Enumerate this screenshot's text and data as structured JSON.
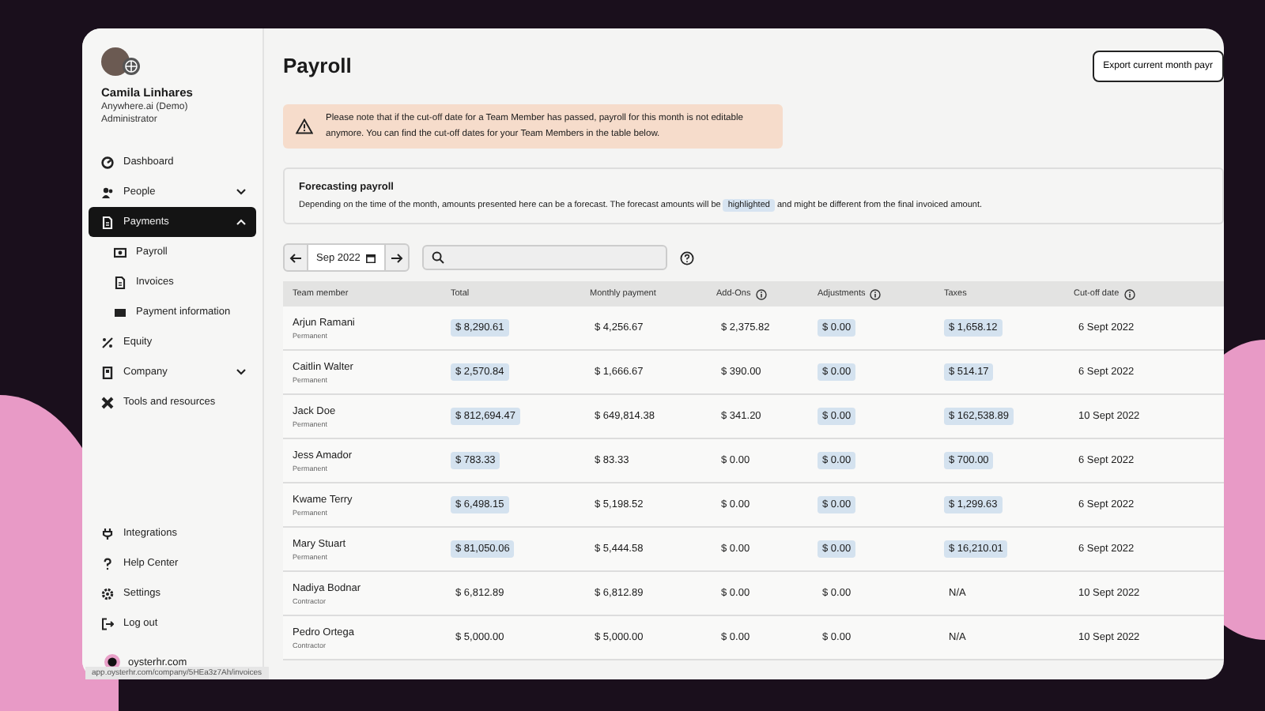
{
  "user": {
    "name": "Camila Linhares",
    "company": "Anywhere.ai (Demo)",
    "role": "Administrator"
  },
  "sidebar": {
    "items": [
      {
        "label": "Dashboard",
        "selected": false
      },
      {
        "label": "People",
        "selected": false,
        "expanded": false
      },
      {
        "label": "Payments",
        "selected": true,
        "expanded": true,
        "children": [
          {
            "label": "Payroll",
            "selected": false
          },
          {
            "label": "Invoices",
            "selected": false
          },
          {
            "label": "Payment information",
            "selected": false
          }
        ]
      },
      {
        "label": "Equity",
        "selected": false
      },
      {
        "label": "Company",
        "selected": false,
        "expanded": false
      },
      {
        "label": "Tools and resources",
        "selected": false
      }
    ],
    "bottom_items": [
      {
        "label": "Integrations",
        "selected": false
      },
      {
        "label": "Help Center",
        "selected": false
      },
      {
        "label": "Settings",
        "selected": false
      },
      {
        "label": "Log out",
        "selected": false
      }
    ],
    "footer": "oysterhr.com"
  },
  "page": {
    "title": "Payroll",
    "export_button": "Export current month payr"
  },
  "alert": "Please note that if the cut-off date for a Team Member has passed, payroll for this month is not editable anymore. You can find the cut-off dates for your Team Members in the table below.",
  "forecast": {
    "title": "Forecasting payroll",
    "text_before": "Depending on the time of the month, amounts presented here can be a forecast. The forecast amounts will be",
    "highlight": "highlighted",
    "text_after": "and might be different from the final invoiced amount."
  },
  "toolbar": {
    "month": "Sep 2022"
  },
  "table": {
    "columns": [
      {
        "label": "Team member",
        "info": false
      },
      {
        "label": "Total",
        "info": false
      },
      {
        "label": "Monthly payment",
        "info": false
      },
      {
        "label": "Add-Ons",
        "info": true
      },
      {
        "label": "Adjustments",
        "info": true
      },
      {
        "label": "Taxes",
        "info": false
      },
      {
        "label": "Cut-off date",
        "info": true
      }
    ],
    "rows": [
      {
        "cells": [
          {
            "text": "Arjun Ramani",
            "subtext": "Permanent"
          },
          {
            "text": "$ 8,290.61",
            "highlighted": true
          },
          {
            "text": "$ 4,256.67",
            "highlighted": false
          },
          {
            "text": "$ 2,375.82",
            "highlighted": false
          },
          {
            "text": "$ 0.00",
            "highlighted": true
          },
          {
            "text": "$ 1,658.12",
            "highlighted": true
          },
          {
            "text": "6 Sept 2022",
            "highlighted": false
          }
        ]
      },
      {
        "cells": [
          {
            "text": "Caitlin Walter",
            "subtext": "Permanent"
          },
          {
            "text": "$ 2,570.84",
            "highlighted": true
          },
          {
            "text": "$ 1,666.67",
            "highlighted": false
          },
          {
            "text": "$ 390.00",
            "highlighted": false
          },
          {
            "text": "$ 0.00",
            "highlighted": true
          },
          {
            "text": "$ 514.17",
            "highlighted": true
          },
          {
            "text": "6 Sept 2022",
            "highlighted": false
          }
        ]
      },
      {
        "cells": [
          {
            "text": "Jack Doe",
            "subtext": "Permanent"
          },
          {
            "text": "$ 812,694.47",
            "highlighted": true
          },
          {
            "text": "$ 649,814.38",
            "highlighted": false
          },
          {
            "text": "$ 341.20",
            "highlighted": false
          },
          {
            "text": "$ 0.00",
            "highlighted": true
          },
          {
            "text": "$ 162,538.89",
            "highlighted": true
          },
          {
            "text": "10 Sept 2022",
            "highlighted": false
          }
        ]
      },
      {
        "cells": [
          {
            "text": "Jess Amador",
            "subtext": "Permanent"
          },
          {
            "text": "$ 783.33",
            "highlighted": true
          },
          {
            "text": "$ 83.33",
            "highlighted": false
          },
          {
            "text": "$ 0.00",
            "highlighted": false
          },
          {
            "text": "$ 0.00",
            "highlighted": true
          },
          {
            "text": "$ 700.00",
            "highlighted": true
          },
          {
            "text": "6 Sept 2022",
            "highlighted": false
          }
        ]
      },
      {
        "cells": [
          {
            "text": "Kwame Terry",
            "subtext": "Permanent"
          },
          {
            "text": "$ 6,498.15",
            "highlighted": true
          },
          {
            "text": "$ 5,198.52",
            "highlighted": false
          },
          {
            "text": "$ 0.00",
            "highlighted": false
          },
          {
            "text": "$ 0.00",
            "highlighted": true
          },
          {
            "text": "$ 1,299.63",
            "highlighted": true
          },
          {
            "text": "6 Sept 2022",
            "highlighted": false
          }
        ]
      },
      {
        "cells": [
          {
            "text": "Mary Stuart",
            "subtext": "Permanent"
          },
          {
            "text": "$ 81,050.06",
            "highlighted": true
          },
          {
            "text": "$ 5,444.58",
            "highlighted": false
          },
          {
            "text": "$ 0.00",
            "highlighted": false
          },
          {
            "text": "$ 0.00",
            "highlighted": true
          },
          {
            "text": "$ 16,210.01",
            "highlighted": true
          },
          {
            "text": "6 Sept 2022",
            "highlighted": false
          }
        ]
      },
      {
        "cells": [
          {
            "text": "Nadiya Bodnar",
            "subtext": "Contractor"
          },
          {
            "text": "$ 6,812.89",
            "highlighted": false
          },
          {
            "text": "$ 6,812.89",
            "highlighted": false
          },
          {
            "text": "$ 0.00",
            "highlighted": false
          },
          {
            "text": "$ 0.00",
            "highlighted": false
          },
          {
            "text": "N/A",
            "highlighted": false
          },
          {
            "text": "10 Sept 2022",
            "highlighted": false
          }
        ]
      },
      {
        "cells": [
          {
            "text": "Pedro Ortega",
            "subtext": "Contractor"
          },
          {
            "text": "$ 5,000.00",
            "highlighted": false
          },
          {
            "text": "$ 5,000.00",
            "highlighted": false
          },
          {
            "text": "$ 0.00",
            "highlighted": false
          },
          {
            "text": "$ 0.00",
            "highlighted": false
          },
          {
            "text": "N/A",
            "highlighted": false
          },
          {
            "text": "10 Sept 2022",
            "highlighted": false
          }
        ]
      }
    ]
  },
  "status_url": "app.oysterhr.com/company/5HEa3z7Ah/invoices"
}
